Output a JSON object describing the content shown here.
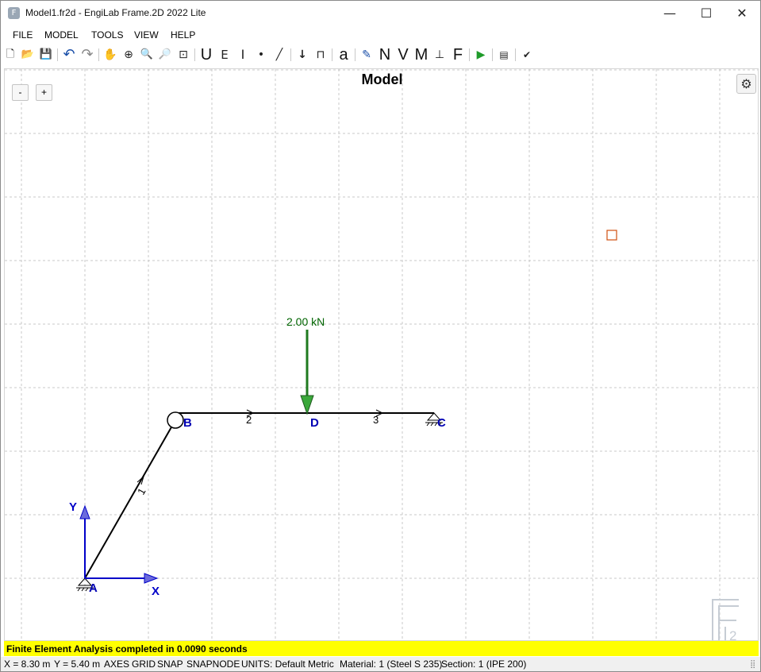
{
  "window": {
    "title": "Model1.fr2d - EngiLab Frame.2D 2022 Lite",
    "app_icon_letter": "F",
    "minimize_glyph": "—",
    "maximize_glyph": "☐",
    "close_glyph": "✕"
  },
  "menu": {
    "items": [
      "FILE",
      "MODEL",
      "TOOLS",
      "VIEW",
      "HELP"
    ]
  },
  "toolbar": {
    "icons": [
      {
        "name": "new-file-icon",
        "glyph": "🗋"
      },
      {
        "name": "open-file-icon",
        "glyph": "📂"
      },
      {
        "name": "save-icon",
        "glyph": "💾"
      },
      {
        "name": "undo-icon",
        "glyph": "↶"
      },
      {
        "name": "redo-icon",
        "glyph": "↷"
      },
      {
        "name": "pan-icon",
        "glyph": "✋"
      },
      {
        "name": "zoom-window-icon",
        "glyph": "⊕"
      },
      {
        "name": "zoom-icon",
        "glyph": "🔍"
      },
      {
        "name": "zoom-out-icon",
        "glyph": "🔎"
      },
      {
        "name": "zoom-extents-icon",
        "glyph": "⊡"
      },
      {
        "name": "units-icon",
        "glyph": "U"
      },
      {
        "name": "material-icon",
        "glyph": "E"
      },
      {
        "name": "section-icon",
        "glyph": "I"
      },
      {
        "name": "node-icon",
        "glyph": "•"
      },
      {
        "name": "element-icon",
        "glyph": "╱"
      },
      {
        "name": "nodal-load-icon",
        "glyph": "↓"
      },
      {
        "name": "support-icon",
        "glyph": "⊓"
      },
      {
        "name": "label-icon",
        "glyph": "a"
      },
      {
        "name": "edit-icon",
        "glyph": "✎"
      },
      {
        "name": "axial-force-icon",
        "glyph": "N"
      },
      {
        "name": "shear-force-icon",
        "glyph": "V"
      },
      {
        "name": "bending-moment-icon",
        "glyph": "M"
      },
      {
        "name": "reactions-icon",
        "glyph": "⊥"
      },
      {
        "name": "forces-icon",
        "glyph": "F"
      },
      {
        "name": "run-analysis-icon",
        "glyph": "▶"
      },
      {
        "name": "report-icon",
        "glyph": "▤"
      },
      {
        "name": "check-icon",
        "glyph": "✔"
      }
    ]
  },
  "canvas": {
    "title": "Model",
    "zoom_out_label": "-",
    "zoom_in_label": "+",
    "settings_glyph": "⚙",
    "axes": {
      "x_label": "X",
      "y_label": "Y"
    },
    "nodes": [
      {
        "id": "A",
        "x": 0,
        "y": 0
      },
      {
        "id": "B",
        "x": 2,
        "y": 3
      },
      {
        "id": "D",
        "x": 4,
        "y": 3
      },
      {
        "id": "C",
        "x": 6,
        "y": 3
      }
    ],
    "elements": [
      {
        "id": "1",
        "from": "A",
        "to": "B"
      },
      {
        "id": "2",
        "from": "B",
        "to": "D"
      },
      {
        "id": "3",
        "from": "D",
        "to": "C"
      }
    ],
    "load": {
      "label": "2.00 kN",
      "node": "D"
    },
    "watermark": "2",
    "colors": {
      "element": "#000000",
      "node_label": "#0000b4",
      "load": "#2e9b2e",
      "load_text": "#006400",
      "axes": "#0000c8",
      "marker": "#d05010",
      "grid": "#c8c8c8"
    }
  },
  "status": {
    "message": "Finite Element Analysis completed in 0.0090 seconds"
  },
  "info": {
    "x": "X = 8.30 m",
    "y": "Y = 5.40 m",
    "axes": "AXES",
    "grid": "GRID",
    "snap": "SNAP",
    "snapnode": "SNAPNODE",
    "units": "UNITS: Default Metric",
    "material": "Material: 1 (Steel S 235)",
    "section": "Section: 1 (IPE 200)"
  }
}
